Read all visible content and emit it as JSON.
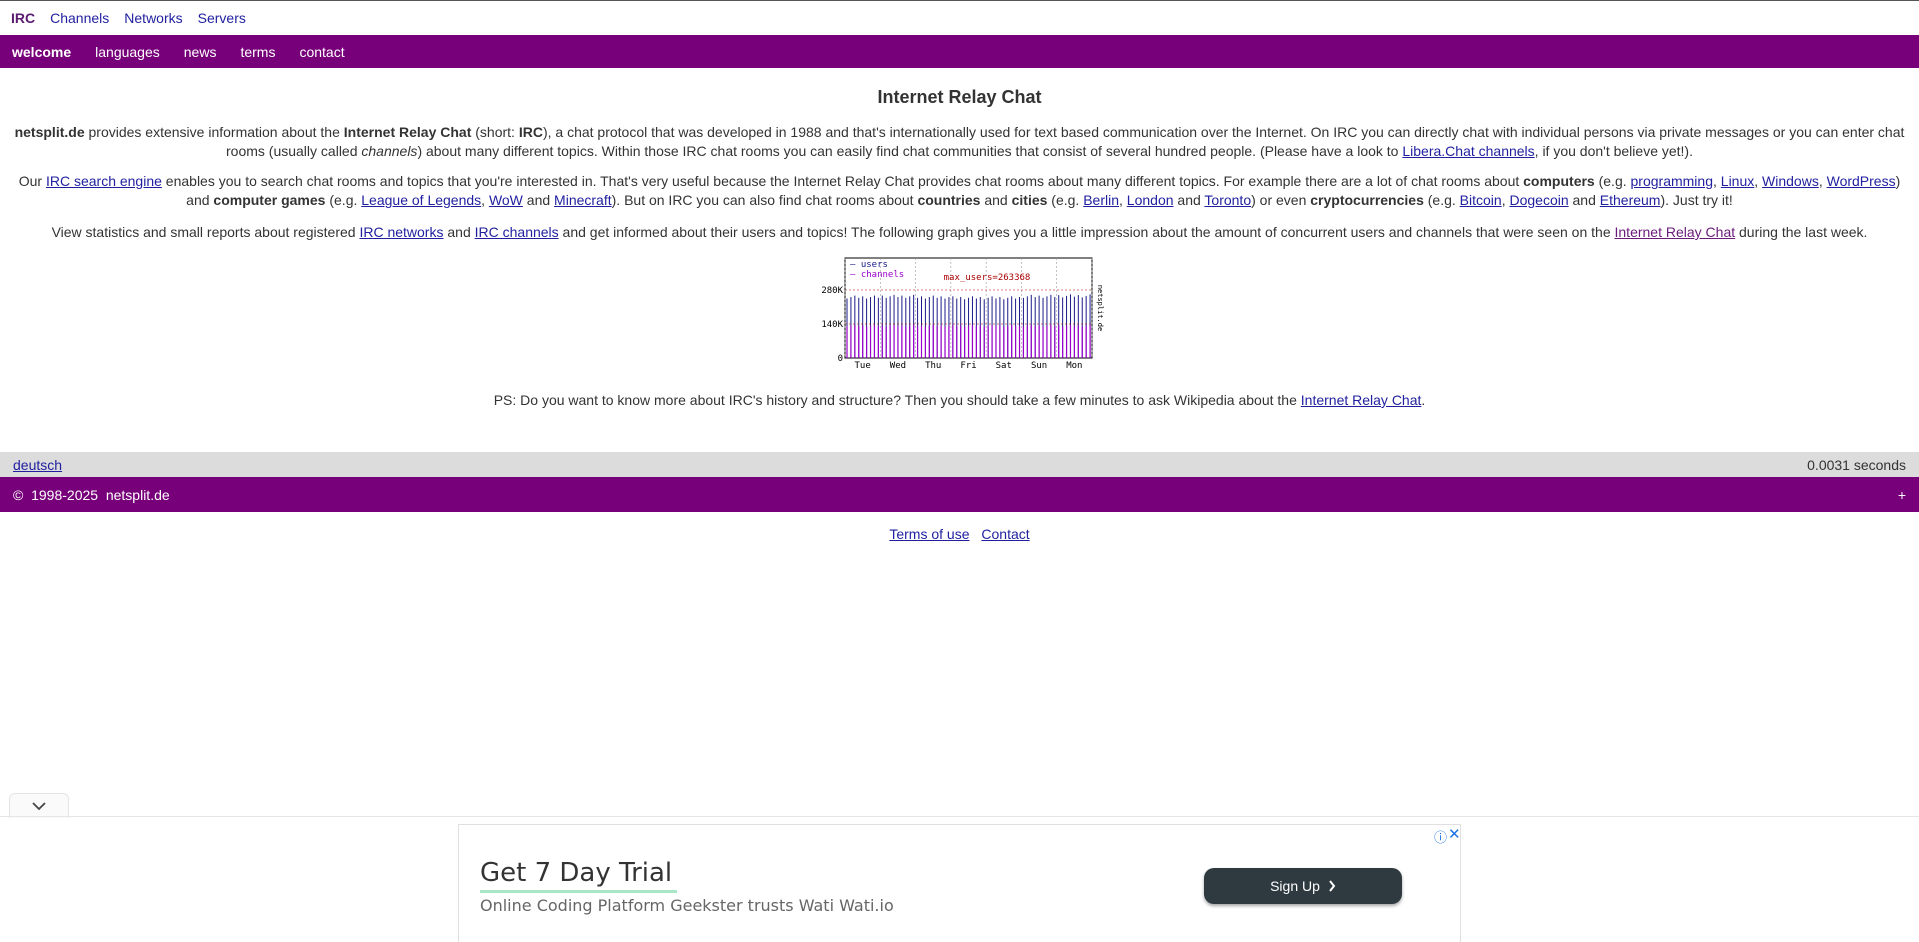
{
  "topnav": {
    "brand": "IRC",
    "items": [
      "Channels",
      "Networks",
      "Servers"
    ]
  },
  "subnav": {
    "items": [
      "welcome",
      "languages",
      "news",
      "terms",
      "contact"
    ],
    "active": "welcome"
  },
  "main": {
    "title": "Internet Relay Chat",
    "p1": {
      "site": "netsplit.de",
      "t1": " provides extensive information about the ",
      "irc_bold": "Internet Relay Chat",
      "t2": " (short: ",
      "irc_short": "IRC",
      "t3": "), a chat protocol that was developed in 1988 and that's internationally used for text based communication over the Internet. On IRC you can directly chat with individual persons via private messages or you can enter chat rooms (usually called ",
      "channels_em": "channels",
      "t4": ") about many different topics. Within those IRC chat rooms you can easily find chat communities that consist of several hundred people. (Please have a look to ",
      "libera_link": "Libera.Chat channels",
      "t5": ", if you don't believe yet!)."
    },
    "p2": {
      "t1": "Our ",
      "search_link": "IRC search engine",
      "t2": " enables you to search chat rooms and topics that you're interested in. That's very useful because the Internet Relay Chat provides chat rooms about many different topics. For example there are a lot of chat rooms about ",
      "computers": "computers",
      "t3": " (e.g. ",
      "programming": "programming",
      "linux": "Linux",
      "windows": "Windows",
      "wordpress": "WordPress",
      "t4": ") and ",
      "games": "computer games",
      "t5": " (e.g. ",
      "lol": "League of Legends",
      "wow": "WoW",
      "and1": " and ",
      "minecraft": "Minecraft",
      "t6": "). But on IRC you can also find chat rooms about ",
      "countries": "countries",
      "and2": " and ",
      "cities": "cities",
      "t7": " (e.g. ",
      "berlin": "Berlin",
      "london": "London",
      "and3": " and ",
      "toronto": "Toronto",
      "t8": ") or even ",
      "crypto": "cryptocurrencies",
      "t9": " (e.g. ",
      "bitcoin": "Bitcoin",
      "dogecoin": "Dogecoin",
      "and4": " and ",
      "ethereum": "Ethereum",
      "t10": "). Just try it!",
      "comma": ", "
    },
    "p3": {
      "t1": "View statistics and small reports about registered ",
      "networks_link": "IRC networks",
      "t2": " and ",
      "channels_link": "IRC channels",
      "t3": " and get informed about their users and topics! The following graph gives you a little impression about the amount of concurrent users and channels that were seen on the ",
      "irc_link": "Internet Relay Chat",
      "t4": " during the last week."
    },
    "ps": {
      "t1": "PS: Do you want to know more about IRC's history and structure? Then you should take a few minutes to ask Wikipedia about the ",
      "wiki_link": "Internet Relay Chat",
      "t2": "."
    }
  },
  "chart_data": {
    "type": "bar",
    "legend": [
      "users",
      "channels"
    ],
    "annotation": "max_users=263368",
    "side_label": "netsplit.de",
    "x_ticks": [
      "Tue",
      "Wed",
      "Thu",
      "Fri",
      "Sat",
      "Sun",
      "Mon"
    ],
    "y_ticks": [
      "0",
      "140K",
      "280K"
    ],
    "ylim": [
      0,
      280000
    ],
    "series": [
      {
        "name": "users",
        "color": "#1a1a8a",
        "approx_values_per_day": [
          255000,
          258000,
          255000,
          252000,
          252000,
          258000,
          260000
        ]
      },
      {
        "name": "channels",
        "color": "#9900cc",
        "approx_values_per_day": [
          135000,
          135000,
          135000,
          135000,
          135000,
          135000,
          135000
        ]
      }
    ]
  },
  "footer": {
    "language_link": "deutsch",
    "timing": "0.0031 seconds",
    "copyright_symbol": "©",
    "copyright": "1998-2025  netsplit.de",
    "plus": "+",
    "terms_link": "Terms of use",
    "contact_link": "Contact"
  },
  "ad": {
    "title": "Get 7 Day Trial",
    "subtitle": "Online Coding Platform Geekster trusts Wati Wati.io",
    "button": "Sign Up",
    "info_icon": "ⓘ",
    "close_icon": "✕"
  }
}
